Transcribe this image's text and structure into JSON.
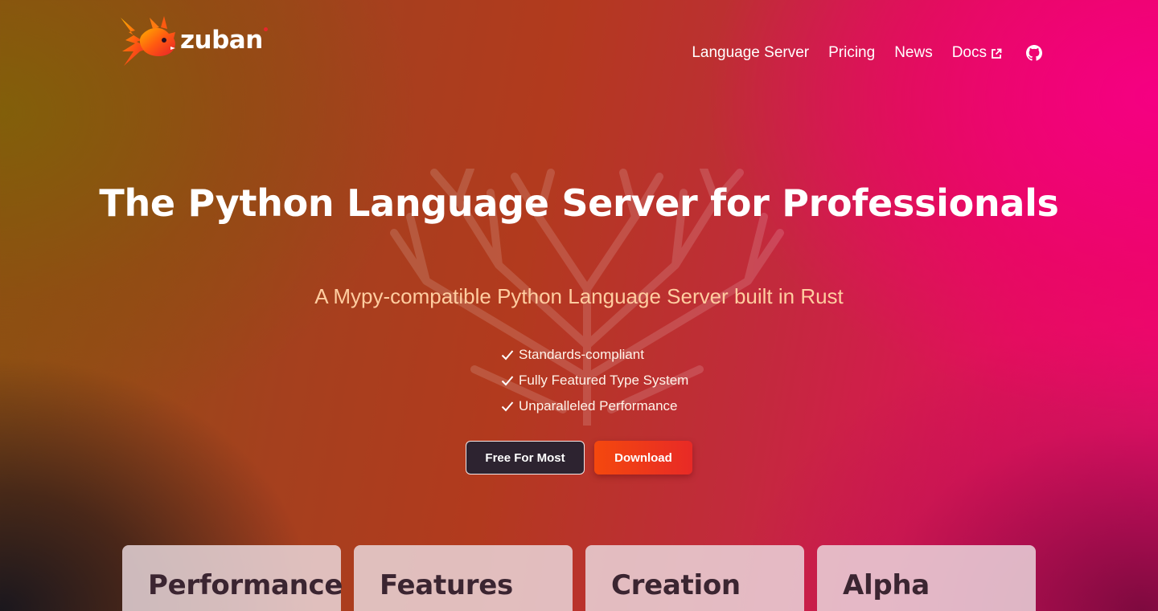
{
  "brand": {
    "name": "zuban",
    "logo_icon": "rabbit-logo-icon"
  },
  "nav": {
    "items": [
      {
        "label": "Language Server"
      },
      {
        "label": "Pricing"
      },
      {
        "label": "News"
      },
      {
        "label": "Docs",
        "icon": "external-link-icon"
      }
    ],
    "github_icon": "github-icon"
  },
  "hero": {
    "title": "The Python Language Server for Professionals",
    "subtitle": "A Mypy-compatible Python Language Server built in Rust",
    "features": [
      "Standards-compliant",
      "Fully Featured Type System",
      "Unparalleled Performance"
    ],
    "buttons": {
      "free": "Free For Most",
      "download": "Download"
    }
  },
  "cards": [
    {
      "title": "Performance"
    },
    {
      "title": "Features"
    },
    {
      "title": "Creation"
    },
    {
      "title": "Alpha"
    }
  ],
  "colors": {
    "subtitle": "#ffcda0",
    "download_button": "#f4480e",
    "free_button": "#2d2330",
    "card_bg": "#ecdce0",
    "card_text": "#3b2531"
  }
}
